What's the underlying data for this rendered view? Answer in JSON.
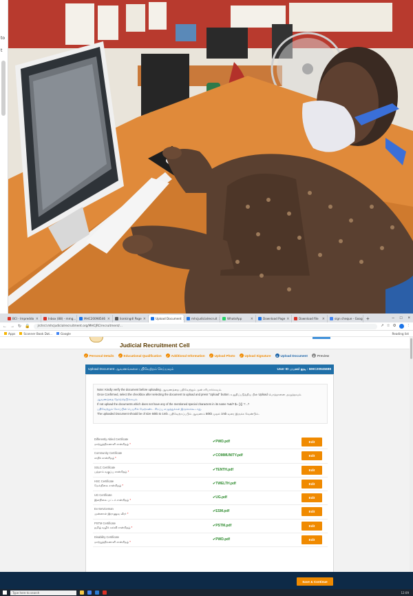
{
  "left_strip": {
    "line1": "to",
    "line2": "t"
  },
  "browser": {
    "tabs": [
      {
        "label": "BCI - Impreddo",
        "color": "#d93025",
        "active": false
      },
      {
        "label": "Inbox (88) - mmg...",
        "color": "#d93025",
        "active": false
      },
      {
        "label": "MHC20098546",
        "color": "#1a73e8",
        "active": false
      },
      {
        "label": "lionkingdl Page",
        "color": "#555555",
        "active": false
      },
      {
        "label": "Upload Document",
        "color": "#1a73e8",
        "active": true
      },
      {
        "label": "mhcjudicialrecruit",
        "color": "#1a73e8",
        "active": false
      },
      {
        "label": "WhatsApp",
        "color": "#25d366",
        "active": false
      },
      {
        "label": "Download Page",
        "color": "#1a73e8",
        "active": false
      },
      {
        "label": "Download file",
        "color": "#d93025",
        "active": false
      },
      {
        "label": "sign cheque - Google",
        "color": "#4285f4",
        "active": false
      }
    ],
    "new_tab": "+",
    "url": "jrchrcl.mhcjudicialrecruitment.org/MHCJRC/recruitment/...",
    "bookmarks": [
      {
        "label": "Apps"
      },
      {
        "label": "Scanner Book Dat..."
      },
      {
        "label": "Google"
      }
    ],
    "reading_list": "Reading list"
  },
  "page": {
    "header_title": "Judicial Recruitment Cell",
    "steps": [
      {
        "label": "Personal Details",
        "state": "done"
      },
      {
        "label": "Educational Qualification",
        "state": "done"
      },
      {
        "label": "Additional Information",
        "state": "done"
      },
      {
        "label": "Upload Photo",
        "state": "done"
      },
      {
        "label": "Upload Signature",
        "state": "done"
      },
      {
        "label": "Upload Document",
        "state": "current"
      },
      {
        "label": "Preview",
        "state": "pending"
      }
    ],
    "section_title": "Upload Document ஆவணங்களை பதிவேற்றம் செய்யவும்",
    "user_id": "User ID பயனர் ஐடி : MHC20945688",
    "notes": [
      {
        "text": "Note: Kindly verify the document before uploading. ஆவணத்தை பதிவேற்றும் முன் சரிபார்க்கவும்.",
        "tamil": false
      },
      {
        "text": "Once Confirmed, select the checkbox after selecting the document to upload and press \"Upload\" button. உறுதிப்படுத்திய பின் Upload பொத்தானை அழுத்தவும்.",
        "tamil": false
      },
      {
        "text": "ஆவணத்தை தேர்ந்தெடுக்கவும்.",
        "tamil": true
      },
      {
        "text": "If not upload the documents which does not have any of the mentioned special characters in its name %&/# $= (){} '!'...?",
        "tamil": false
      },
      {
        "text": "பதிவேற்றும் கோப்பின் பெயரில் மேற்கண்ட சிறப்பு எழுத்துக்கள் இருக்கக்கூடாது.",
        "tamil": true
      },
      {
        "text": "The uploaded Document should be of size 50kb to 1mb. பதிவேற்றப்படும் ஆவணம் 50kb முதல் 1mb வரை இருக்க வேண்டும்.",
        "tamil": false
      }
    ],
    "documents": [
      {
        "name": "Differently Abled Certificate",
        "tamil": "மாற்றுத்திறனாளி சான்றிதழ்",
        "file": "PWD.pdf",
        "action": "Edit"
      },
      {
        "name": "Community Certificate",
        "tamil": "சாதிச் சான்றிதழ்",
        "file": "COMMUNITY.pdf",
        "action": "Edit"
      },
      {
        "name": "SSLC Certificate",
        "tamil": "பத்தாம் வகுப்பு சான்றிதழ்",
        "file": "TENTH.pdf",
        "action": "Edit"
      },
      {
        "name": "HSC Certificate",
        "tamil": "மேல்நிலை சான்றிதழ்",
        "file": "TWELTH.pdf",
        "action": "Edit"
      },
      {
        "name": "UG Certificate",
        "tamil": "இளநிலை பட்டச் சான்றிதழ்",
        "file": "UG.pdf",
        "action": "Edit"
      },
      {
        "name": "Ex-Serviceman",
        "tamil": "முன்னாள் இராணுவ வீரர்",
        "file": "ESM.pdf",
        "action": "Edit"
      },
      {
        "name": "PSTM Certificate",
        "tamil": "தமிழ் வழிக் கல்வி சான்றிதழ்",
        "file": "PSTM.pdf",
        "action": "Edit"
      },
      {
        "name": "Disability Certificate",
        "tamil": "மாற்றுத்திறனாளி சான்றிதழ்",
        "file": "PWD.pdf",
        "action": "Edit"
      }
    ],
    "save_button": "Save & Continue"
  },
  "taskbar": {
    "search_placeholder": "Type here to search",
    "clock": "12:09"
  },
  "colors": {
    "accent": "#f08a00",
    "blue": "#1f6fa8",
    "footer": "#0e2a47",
    "success": "#2e8b2e"
  }
}
